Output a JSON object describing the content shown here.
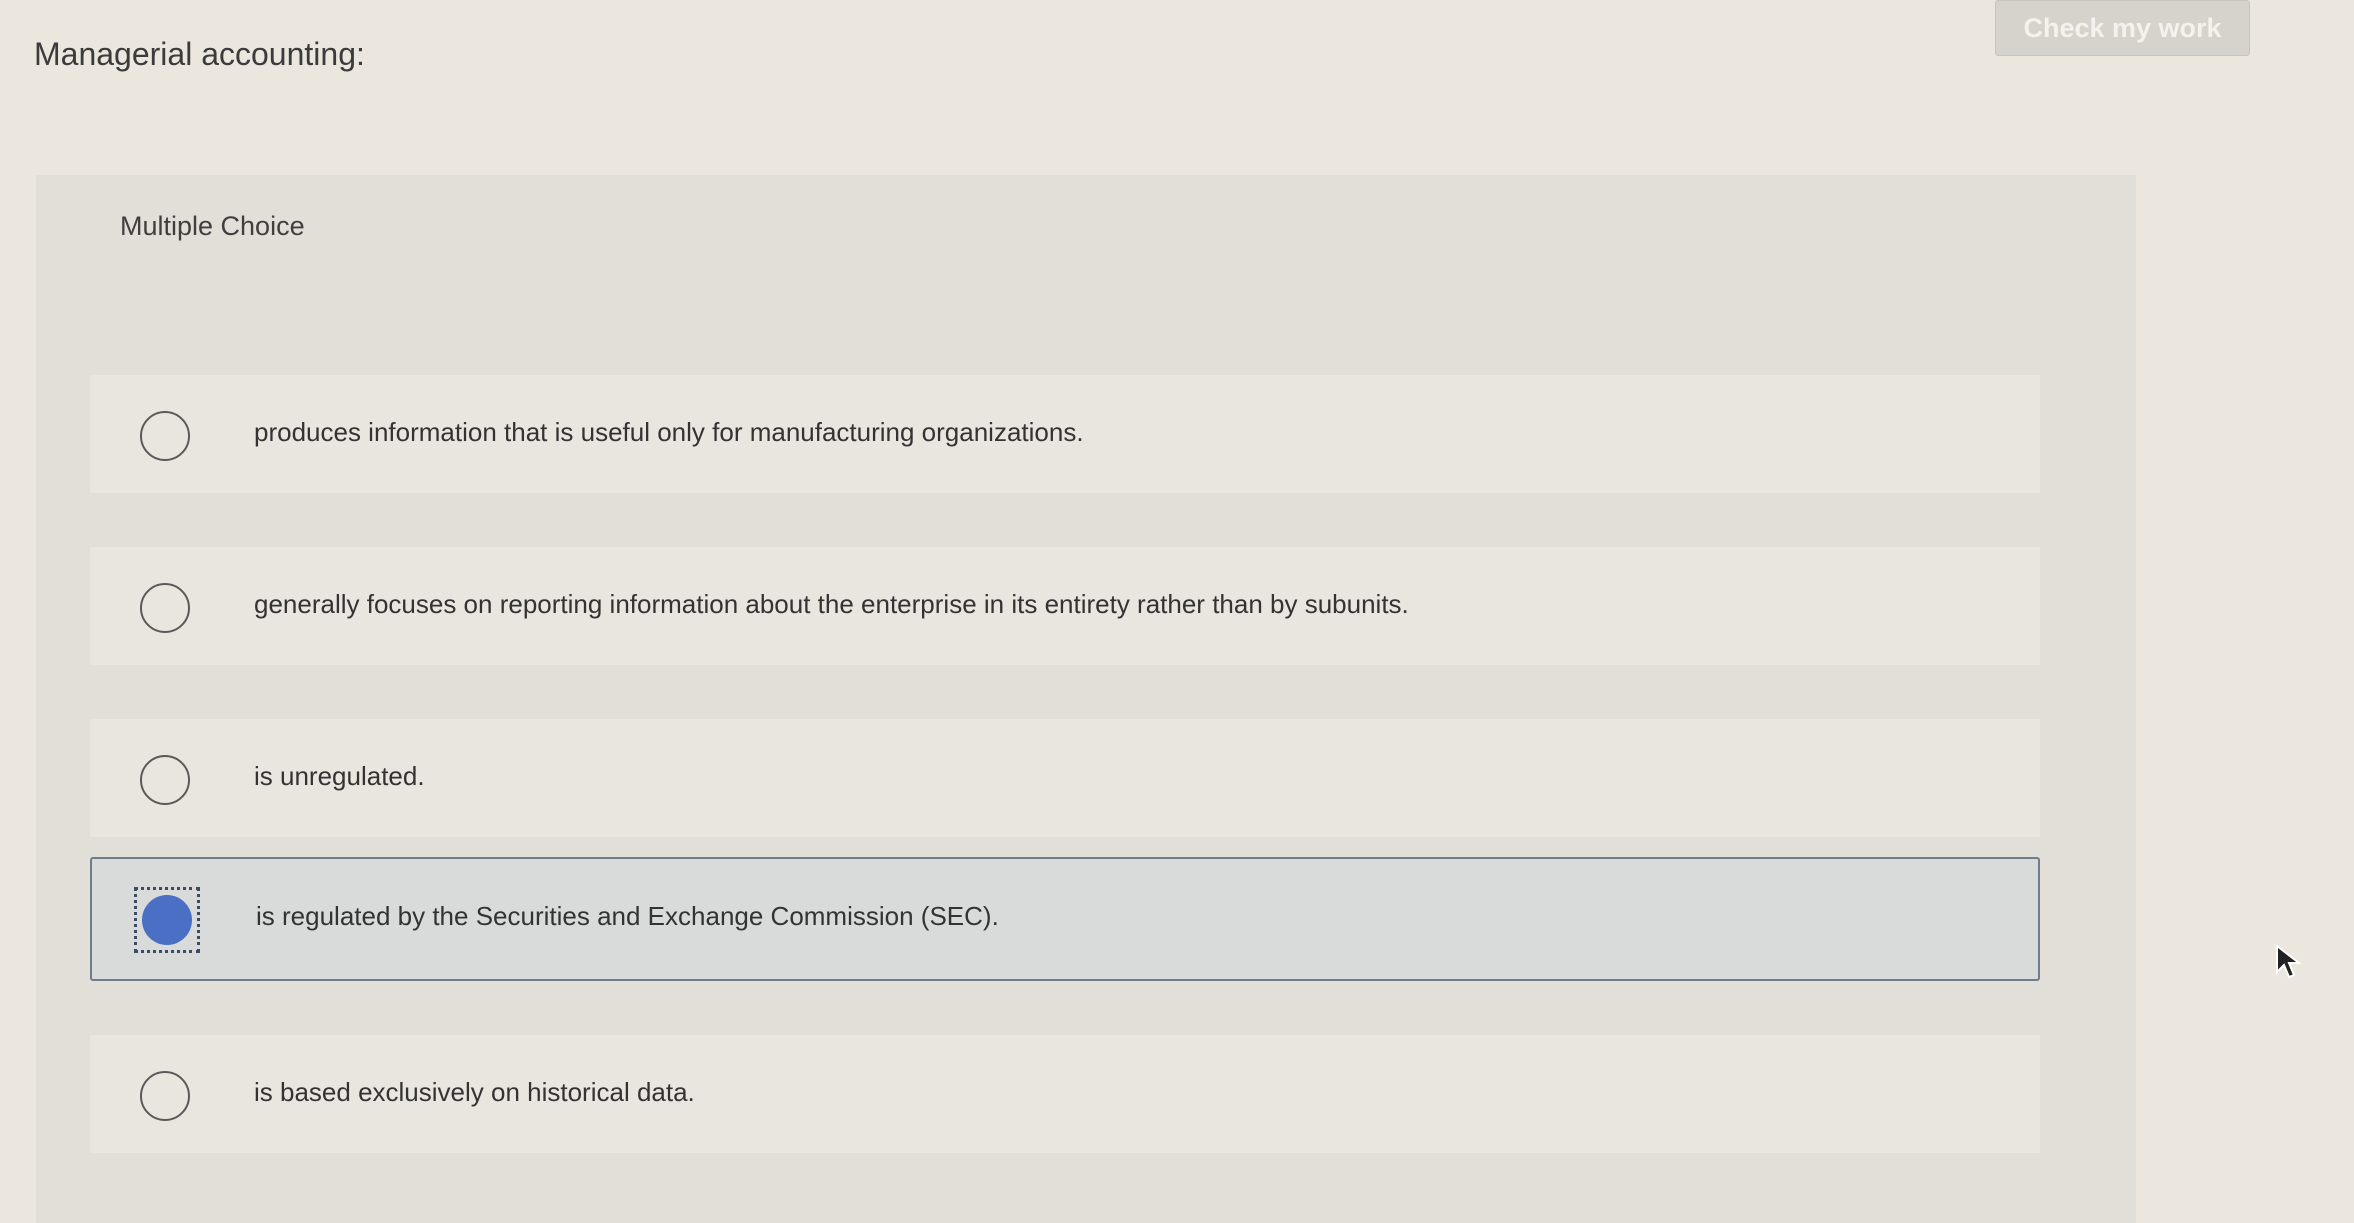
{
  "question": {
    "title": "Managerial accounting:"
  },
  "toolbar": {
    "check_label": "Check my work"
  },
  "panel": {
    "type_label": "Multiple Choice"
  },
  "choices": [
    {
      "text": "produces information that is useful only for manufacturing organizations.",
      "selected": false
    },
    {
      "text": "generally focuses on reporting information about the enterprise in its entirety rather than by subunits.",
      "selected": false
    },
    {
      "text": "is unregulated.",
      "selected": false
    },
    {
      "text": "is regulated by the Securities and Exchange Commission (SEC).",
      "selected": true
    },
    {
      "text": "is based exclusively on historical data.",
      "selected": false
    }
  ],
  "colors": {
    "accent": "#4a6fc4",
    "selected_border": "#6f7c8e",
    "background": "#ebe7df"
  },
  "icons": {
    "cursor": "mouse-pointer-icon"
  }
}
